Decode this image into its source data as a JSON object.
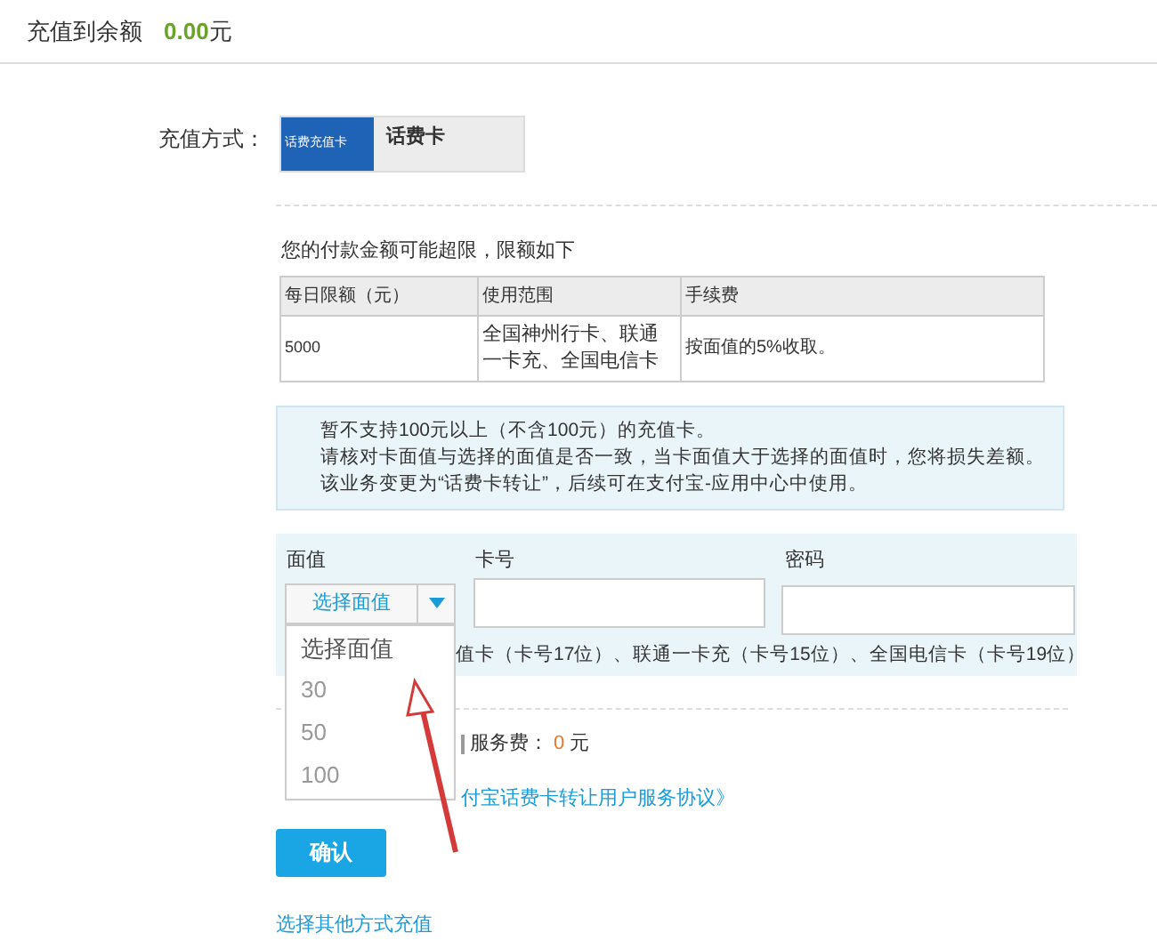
{
  "balance": {
    "label": "充值到余额",
    "amount": "0.00",
    "unit": "元"
  },
  "method": {
    "label": "充值方式：",
    "card_picture_text": "话费充值卡",
    "card_name": "话费卡"
  },
  "limit_notice": "您的付款金额可能超限，限额如下",
  "limit_table": {
    "columns": [
      "每日限额（元）",
      "使用范围",
      "手续费"
    ],
    "rows": [
      [
        "5000",
        "全国神州行卡、联通一卡充、全国电信卡",
        "按面值的5%收取。"
      ]
    ]
  },
  "notes": [
    "暂不支持100元以上（不含100元）的充值卡。",
    "请核对卡面值与选择的面值是否一致，当卡面值大于选择的面值时，您将损失差额。",
    "该业务变更为“话费卡转让”，后续可在支付宝-应用中心中使用。"
  ],
  "form": {
    "value_label": "面值",
    "select_text": "选择面值",
    "card_label": "卡号",
    "password_label": "密码",
    "hint": "值卡（卡号17位）、联通一卡充（卡号15位）、全国电信卡（卡号19位）",
    "dropdown": {
      "expanded": true,
      "options": [
        "选择面值",
        "30",
        "50",
        "100"
      ]
    }
  },
  "fee": {
    "label": "服务费：",
    "amount": "0",
    "unit": "元"
  },
  "agreement_link": "付宝话费卡转让用户服务协议》",
  "confirm_button": "确认",
  "other_method_link": "选择其他方式充值"
}
